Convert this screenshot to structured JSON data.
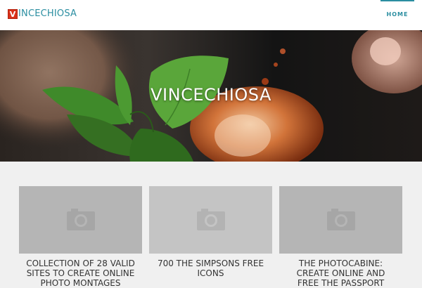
{
  "header": {
    "logo_letter": "V",
    "logo_text": "INCECHIOSA",
    "nav": [
      {
        "label": "HOME",
        "active": true
      }
    ]
  },
  "hero": {
    "title": "VINCECHIOSA"
  },
  "posts": [
    {
      "title": "COLLECTION OF 28 VALID SITES TO CREATE ONLINE PHOTO MONTAGES",
      "image_icon": "camera-icon"
    },
    {
      "title": "700 THE SIMPSONS FREE ICONS",
      "image_icon": "camera-icon"
    },
    {
      "title": "THE PHOTOCABINE: CREATE ONLINE AND FREE THE PASSPORT",
      "image_icon": "camera-icon"
    }
  ],
  "colors": {
    "accent": "#2b8ea1",
    "logo_red": "#d8311a",
    "page_bg": "#f0f0f0"
  }
}
